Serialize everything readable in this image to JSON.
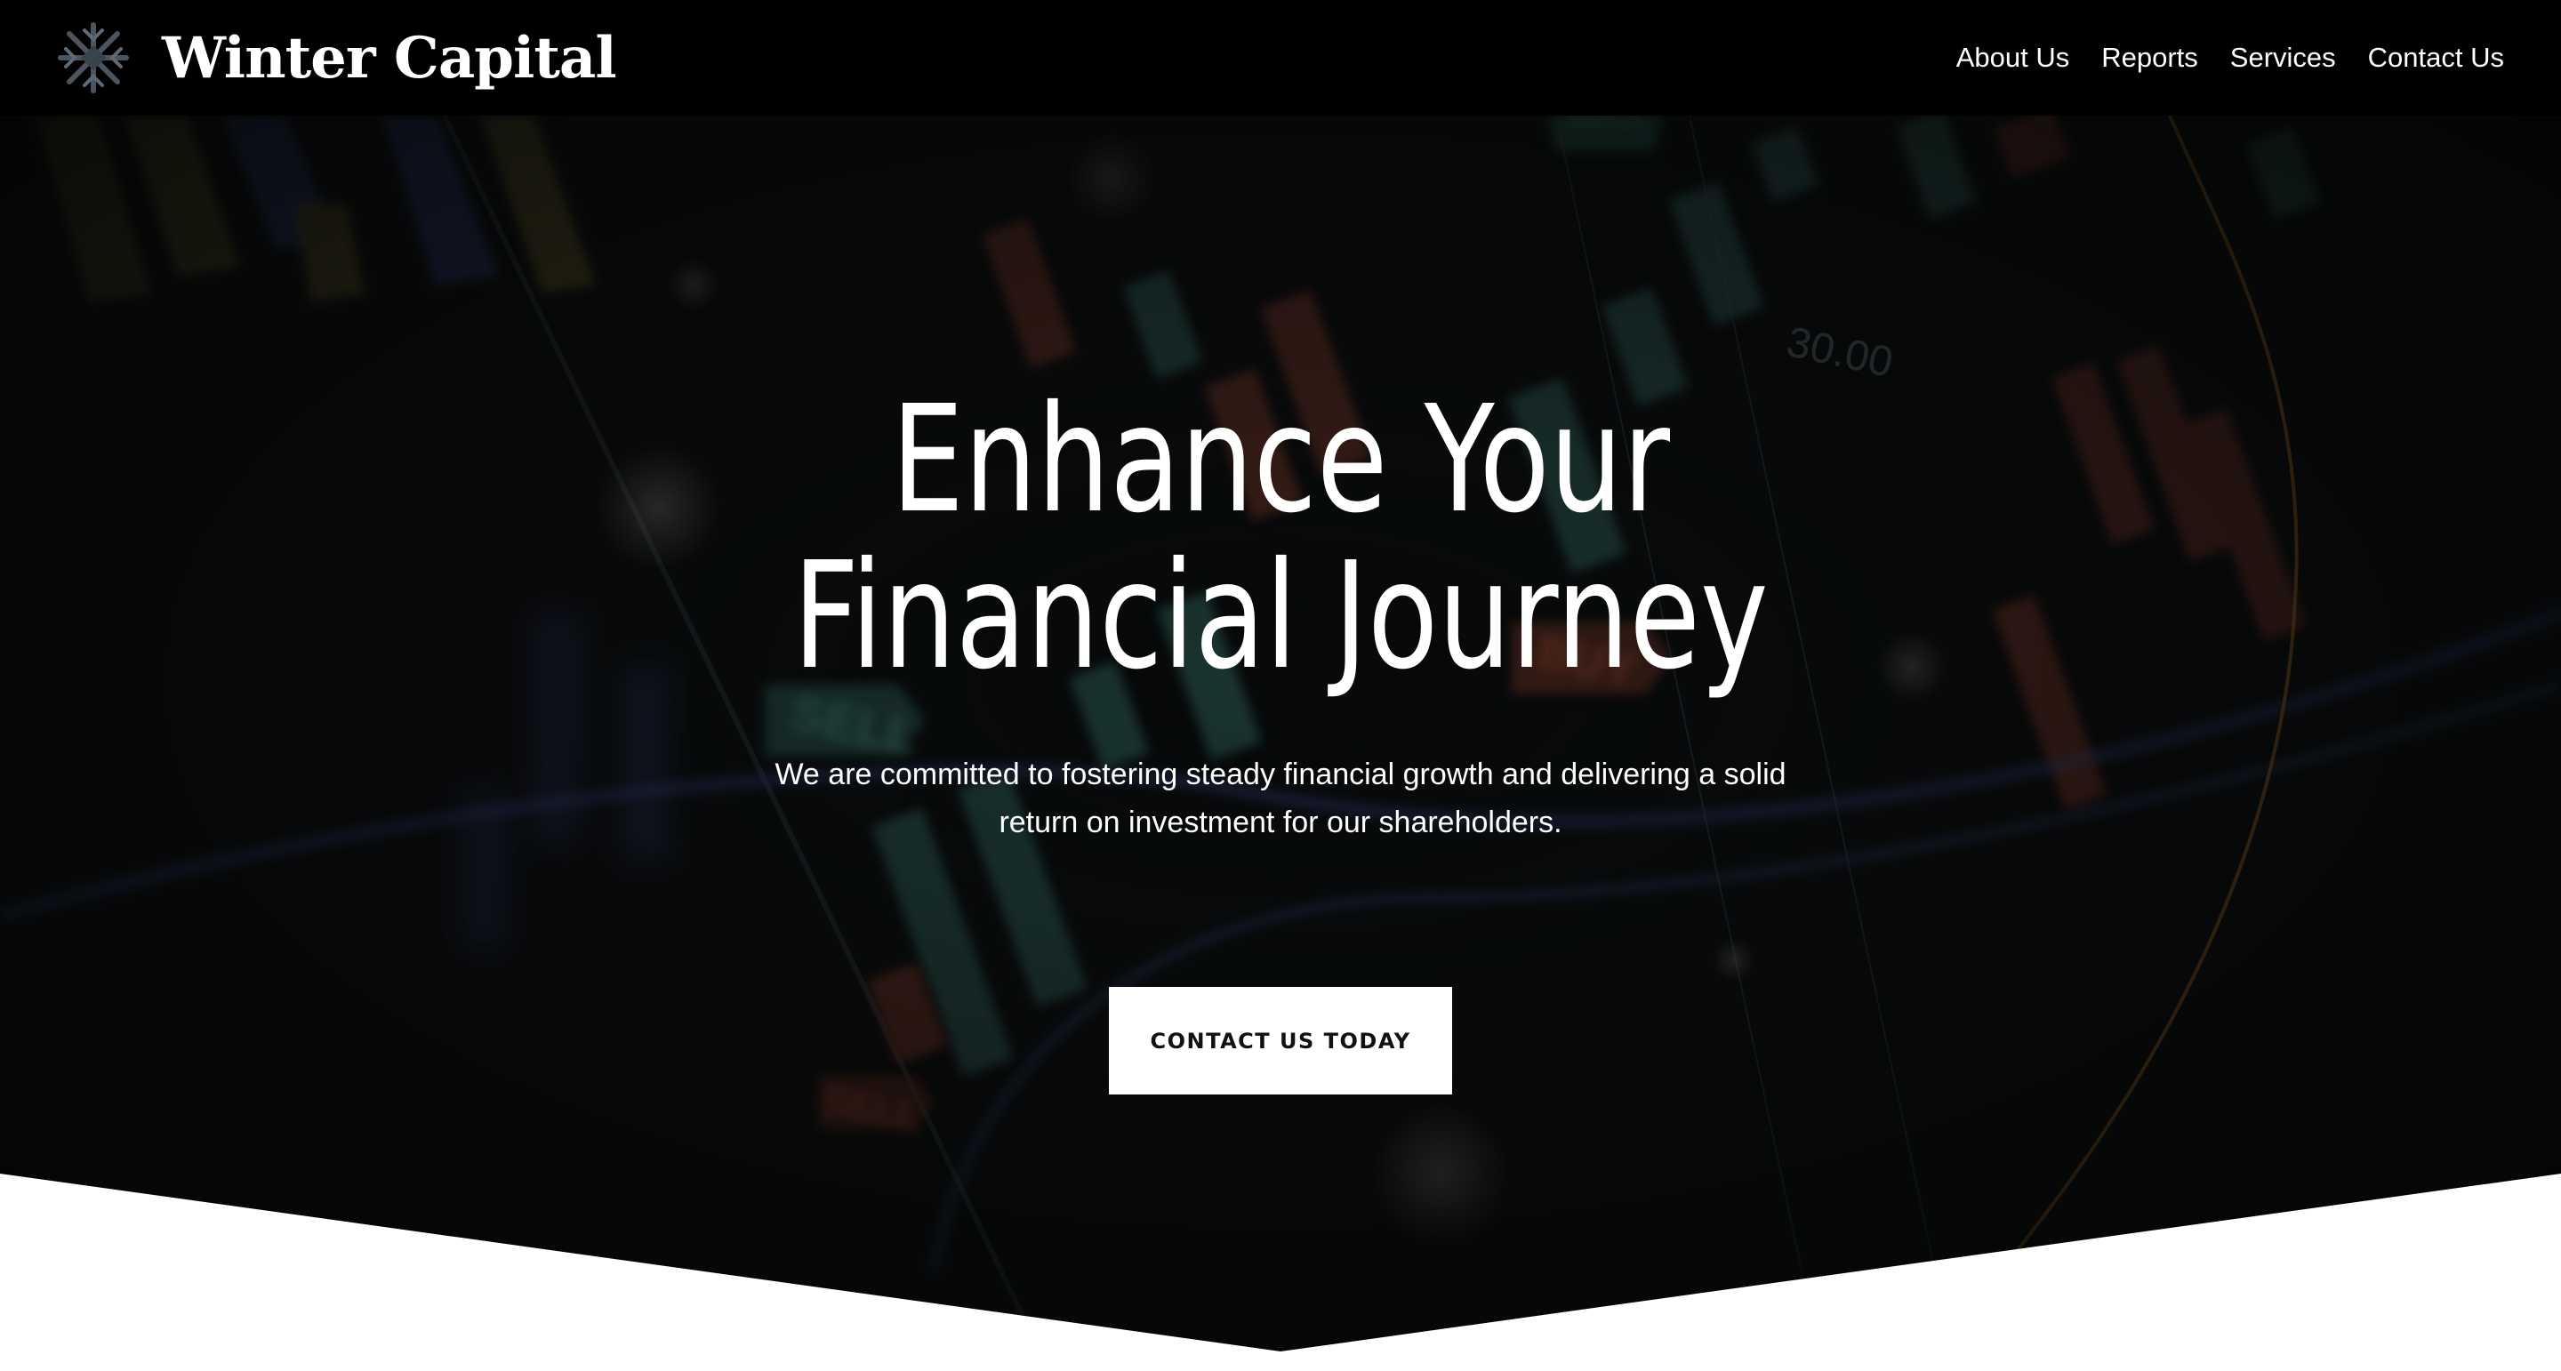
{
  "header": {
    "brand_name": "Winter Capital",
    "logo_icon": "snowflake-icon",
    "nav": [
      {
        "label": "About Us"
      },
      {
        "label": "Reports"
      },
      {
        "label": "Services"
      },
      {
        "label": "Contact Us"
      }
    ]
  },
  "hero": {
    "title_line1": "Enhance Your",
    "title_line2": "Financial Journey",
    "subtitle_line1": "We are committed to fostering steady financial growth and delivering a solid",
    "subtitle_line2": "return on investment for our shareholders.",
    "cta_label": "CONTACT US TODAY",
    "background": {
      "description_icon": "stock-candlestick-background",
      "tags": [
        "SELL",
        "BUY",
        "SELL",
        "SELL",
        "30.00"
      ]
    }
  },
  "colors": {
    "header_bg": "#000000",
    "hero_bg": "#0a0b0c",
    "candle_green": "#2e5a52",
    "candle_red": "#6b3325",
    "accent_orange": "#b8742a",
    "accent_blue": "#3a4a8a",
    "cta_bg": "#ffffff",
    "text": "#ffffff"
  }
}
